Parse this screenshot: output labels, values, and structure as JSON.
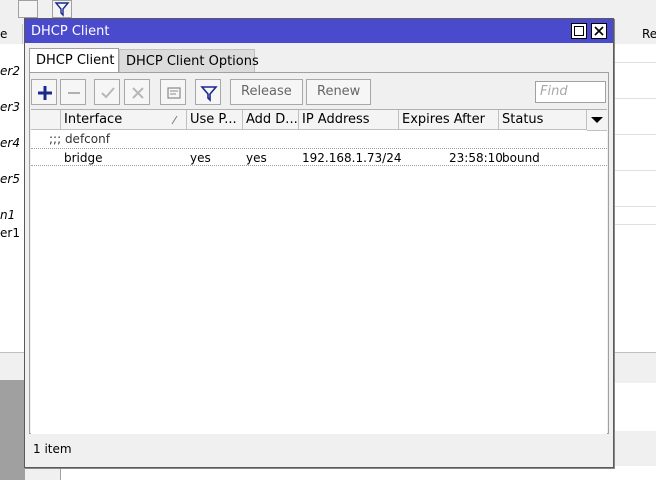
{
  "background": {
    "left_column_header": "e",
    "right_column_header": "Re",
    "left_rows": [
      "er2",
      "er3",
      "er4",
      "er5",
      "n1",
      "er1"
    ]
  },
  "dialog": {
    "title": "DHCP Client",
    "tabs": [
      {
        "label": "DHCP Client",
        "active": true
      },
      {
        "label": "DHCP Client Options",
        "active": false
      }
    ],
    "toolbar": {
      "add_icon": "plus-icon",
      "remove_icon": "minus-icon",
      "enable_icon": "check-icon",
      "disable_icon": "x-icon",
      "comment_icon": "comment-icon",
      "filter_icon": "filter-icon",
      "release_label": "Release",
      "renew_label": "Renew",
      "find_placeholder": "Find"
    },
    "table": {
      "columns": [
        "Interface",
        "Use P...",
        "Add D...",
        "IP Address",
        "Expires After",
        "Status"
      ],
      "group_label": ";;; defconf",
      "rows": [
        {
          "interface": "bridge",
          "use_peer": "yes",
          "add_default": "yes",
          "ip_address": "192.168.1.73/24",
          "expires_after": "23:58:10",
          "status": "bound"
        }
      ]
    },
    "status_text": "1 item"
  },
  "colors": {
    "titlebar": "#4a4acc",
    "add_icon": "#1a2a8c"
  }
}
